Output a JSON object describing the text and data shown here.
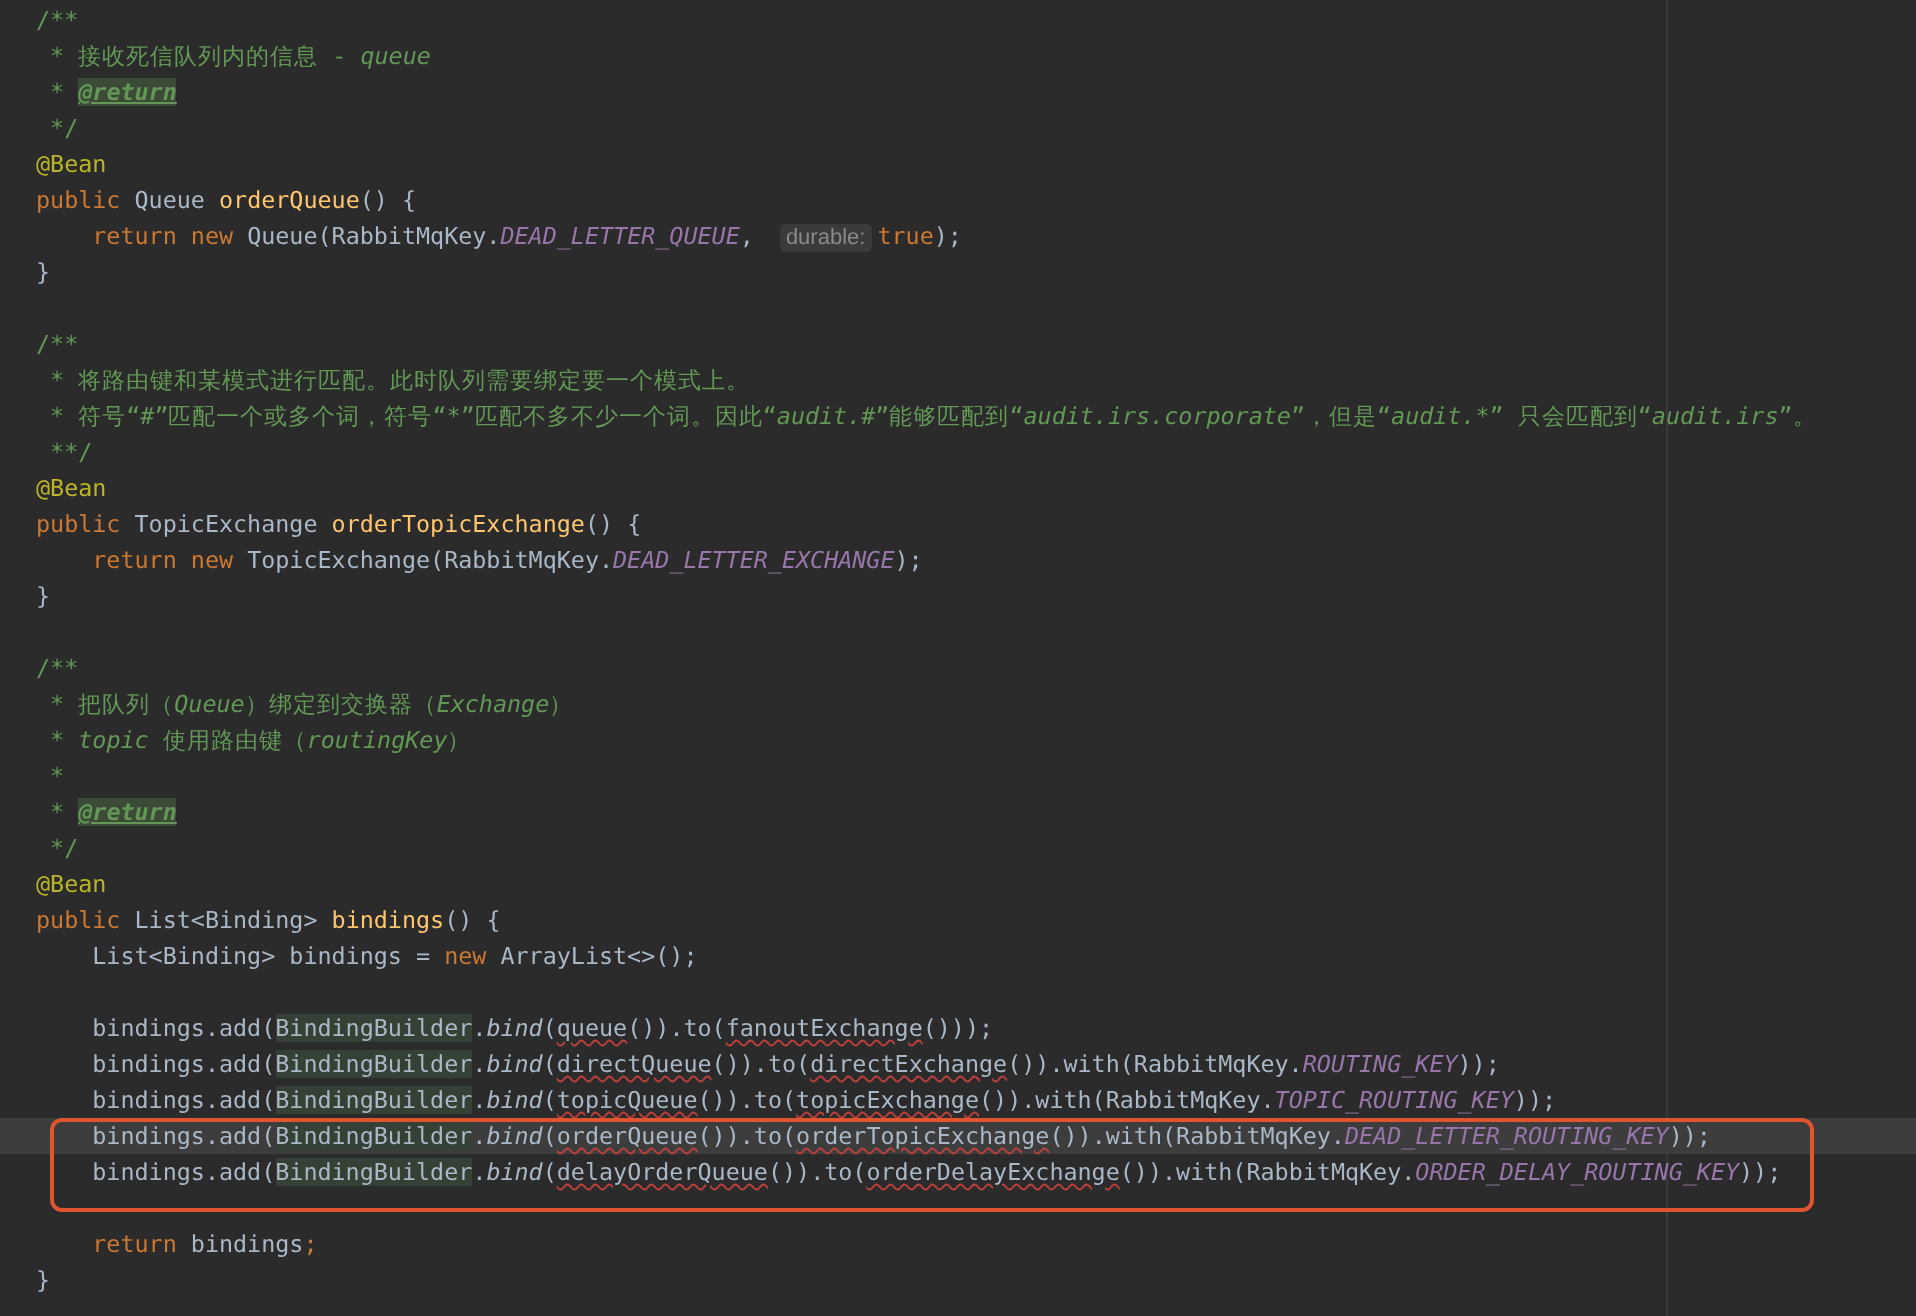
{
  "lines": [
    {
      "kind": "code",
      "current": false,
      "boxed": false,
      "tokens": [
        {
          "kind": "doc",
          "text": "/**"
        }
      ]
    },
    {
      "kind": "code",
      "current": false,
      "boxed": false,
      "tokens": [
        {
          "kind": "doc",
          "text": " * 接收死信队列内的信息 - "
        },
        {
          "kind": "doci",
          "text": "queue"
        }
      ]
    },
    {
      "kind": "code",
      "current": false,
      "boxed": false,
      "tokens": [
        {
          "kind": "doc",
          "text": " * "
        },
        {
          "kind": "tag",
          "text": "@return"
        }
      ]
    },
    {
      "kind": "code",
      "current": false,
      "boxed": false,
      "tokens": [
        {
          "kind": "doc",
          "text": " */"
        }
      ]
    },
    {
      "kind": "code",
      "current": false,
      "boxed": false,
      "tokens": [
        {
          "kind": "ann",
          "text": "@Bean"
        }
      ]
    },
    {
      "kind": "code",
      "current": false,
      "boxed": false,
      "tokens": [
        {
          "kind": "kw",
          "text": "public "
        },
        {
          "kind": "plain",
          "text": "Queue "
        },
        {
          "kind": "fn",
          "text": "orderQueue"
        },
        {
          "kind": "plain",
          "text": "() {"
        }
      ]
    },
    {
      "kind": "code",
      "current": false,
      "boxed": false,
      "tokens": [
        {
          "kind": "kw",
          "text": "    return new "
        },
        {
          "kind": "plain",
          "text": "Queue(RabbitMqKey."
        },
        {
          "kind": "const",
          "text": "DEAD_LETTER_QUEUE"
        },
        {
          "kind": "plain",
          "text": ", "
        },
        {
          "kind": "hint",
          "text": "durable:"
        },
        {
          "kind": "kw",
          "text": "true"
        },
        {
          "kind": "plain",
          "text": ");"
        }
      ]
    },
    {
      "kind": "code",
      "current": false,
      "boxed": false,
      "tokens": [
        {
          "kind": "plain",
          "text": "}"
        }
      ]
    },
    {
      "kind": "blank",
      "current": false,
      "boxed": false
    },
    {
      "kind": "code",
      "current": false,
      "boxed": false,
      "tokens": [
        {
          "kind": "doc",
          "text": "/**"
        }
      ]
    },
    {
      "kind": "code",
      "current": false,
      "boxed": false,
      "tokens": [
        {
          "kind": "doc",
          "text": " * 将路由键和某模式进行匹配。此时队列需要绑定要一个模式上。"
        }
      ]
    },
    {
      "kind": "code",
      "current": false,
      "boxed": false,
      "tokens": [
        {
          "kind": "doc",
          "text": " * 符号“"
        },
        {
          "kind": "doci",
          "text": "#"
        },
        {
          "kind": "doc",
          "text": "”匹配一个或多个词，符号“"
        },
        {
          "kind": "doci",
          "text": "*"
        },
        {
          "kind": "doc",
          "text": "”匹配不多不少一个词。因此“"
        },
        {
          "kind": "doci",
          "text": "audit.#"
        },
        {
          "kind": "doc",
          "text": "”能够匹配到“"
        },
        {
          "kind": "doci",
          "text": "audit.irs.corporate"
        },
        {
          "kind": "doc",
          "text": "”，但是“"
        },
        {
          "kind": "doci",
          "text": "audit.*"
        },
        {
          "kind": "doc",
          "text": "” 只会匹配到“"
        },
        {
          "kind": "doci",
          "text": "audit.irs"
        },
        {
          "kind": "doc",
          "text": "”。"
        }
      ]
    },
    {
      "kind": "code",
      "current": false,
      "boxed": false,
      "tokens": [
        {
          "kind": "doc",
          "text": " **/"
        }
      ]
    },
    {
      "kind": "code",
      "current": false,
      "boxed": false,
      "tokens": [
        {
          "kind": "ann",
          "text": "@Bean"
        }
      ]
    },
    {
      "kind": "code",
      "current": false,
      "boxed": false,
      "tokens": [
        {
          "kind": "kw",
          "text": "public "
        },
        {
          "kind": "plain",
          "text": "TopicExchange "
        },
        {
          "kind": "fn",
          "text": "orderTopicExchange"
        },
        {
          "kind": "plain",
          "text": "() {"
        }
      ]
    },
    {
      "kind": "code",
      "current": false,
      "boxed": false,
      "tokens": [
        {
          "kind": "kw",
          "text": "    return new "
        },
        {
          "kind": "plain",
          "text": "TopicExchange(RabbitMqKey."
        },
        {
          "kind": "const",
          "text": "DEAD_LETTER_EXCHANGE"
        },
        {
          "kind": "plain",
          "text": ");"
        }
      ]
    },
    {
      "kind": "code",
      "current": false,
      "boxed": false,
      "tokens": [
        {
          "kind": "plain",
          "text": "}"
        }
      ]
    },
    {
      "kind": "blank",
      "current": false,
      "boxed": false
    },
    {
      "kind": "code",
      "current": false,
      "boxed": false,
      "tokens": [
        {
          "kind": "doc",
          "text": "/**"
        }
      ]
    },
    {
      "kind": "code",
      "current": false,
      "boxed": false,
      "tokens": [
        {
          "kind": "doc",
          "text": " * 把队列（"
        },
        {
          "kind": "doci",
          "text": "Queue"
        },
        {
          "kind": "doc",
          "text": "）绑定到交换器（"
        },
        {
          "kind": "doci",
          "text": "Exchange"
        },
        {
          "kind": "doc",
          "text": "）"
        }
      ]
    },
    {
      "kind": "code",
      "current": false,
      "boxed": false,
      "tokens": [
        {
          "kind": "doc",
          "text": " * "
        },
        {
          "kind": "doci",
          "text": "topic"
        },
        {
          "kind": "doc",
          "text": " 使用路由键（"
        },
        {
          "kind": "doci",
          "text": "routingKey"
        },
        {
          "kind": "doc",
          "text": "）"
        }
      ]
    },
    {
      "kind": "code",
      "current": false,
      "boxed": false,
      "tokens": [
        {
          "kind": "doc",
          "text": " *"
        }
      ]
    },
    {
      "kind": "code",
      "current": false,
      "boxed": false,
      "tokens": [
        {
          "kind": "doc",
          "text": " * "
        },
        {
          "kind": "tag",
          "text": "@return"
        }
      ]
    },
    {
      "kind": "code",
      "current": false,
      "boxed": false,
      "tokens": [
        {
          "kind": "doc",
          "text": " */"
        }
      ]
    },
    {
      "kind": "code",
      "current": false,
      "boxed": false,
      "tokens": [
        {
          "kind": "ann",
          "text": "@Bean"
        }
      ]
    },
    {
      "kind": "code",
      "current": false,
      "boxed": false,
      "tokens": [
        {
          "kind": "kw",
          "text": "public "
        },
        {
          "kind": "plain",
          "text": "List<Binding> "
        },
        {
          "kind": "fn",
          "text": "bindings"
        },
        {
          "kind": "plain",
          "text": "() {"
        }
      ]
    },
    {
      "kind": "code",
      "current": false,
      "boxed": false,
      "tokens": [
        {
          "kind": "plain",
          "text": "    List<Binding> bindings = "
        },
        {
          "kind": "kw",
          "text": "new "
        },
        {
          "kind": "plain",
          "text": "ArrayList<>();"
        }
      ]
    },
    {
      "kind": "blank",
      "current": false,
      "boxed": false
    },
    {
      "kind": "code",
      "current": false,
      "boxed": false,
      "tokens": [
        {
          "kind": "plain",
          "text": "    bindings.add("
        },
        {
          "kind": "cls",
          "text": "BindingBuilder"
        },
        {
          "kind": "plain",
          "text": "."
        },
        {
          "kind": "static",
          "text": "bind"
        },
        {
          "kind": "plain",
          "text": "("
        },
        {
          "kind": "warn",
          "text": "queue"
        },
        {
          "kind": "plain",
          "text": "()).to("
        },
        {
          "kind": "warn",
          "text": "fanoutExchange"
        },
        {
          "kind": "plain",
          "text": "()));"
        }
      ]
    },
    {
      "kind": "code",
      "current": false,
      "boxed": false,
      "tokens": [
        {
          "kind": "plain",
          "text": "    bindings.add("
        },
        {
          "kind": "cls",
          "text": "BindingBuilder"
        },
        {
          "kind": "plain",
          "text": "."
        },
        {
          "kind": "static",
          "text": "bind"
        },
        {
          "kind": "plain",
          "text": "("
        },
        {
          "kind": "warn",
          "text": "directQueue"
        },
        {
          "kind": "plain",
          "text": "()).to("
        },
        {
          "kind": "warn",
          "text": "directExchange"
        },
        {
          "kind": "plain",
          "text": "()).with(RabbitMqKey."
        },
        {
          "kind": "const",
          "text": "ROUTING_KEY"
        },
        {
          "kind": "plain",
          "text": "));"
        }
      ]
    },
    {
      "kind": "code",
      "current": false,
      "boxed": false,
      "tokens": [
        {
          "kind": "plain",
          "text": "    bindings.add("
        },
        {
          "kind": "cls",
          "text": "BindingBuilder"
        },
        {
          "kind": "plain",
          "text": "."
        },
        {
          "kind": "static",
          "text": "bind"
        },
        {
          "kind": "plain",
          "text": "("
        },
        {
          "kind": "warn",
          "text": "topicQueue"
        },
        {
          "kind": "plain",
          "text": "()).to("
        },
        {
          "kind": "warn",
          "text": "topicExchange"
        },
        {
          "kind": "plain",
          "text": "()).with(RabbitMqKey."
        },
        {
          "kind": "const",
          "text": "TOPIC_ROUTING_KEY"
        },
        {
          "kind": "plain",
          "text": "));"
        }
      ]
    },
    {
      "kind": "code",
      "current": true,
      "boxed": true,
      "tokens": [
        {
          "kind": "plain",
          "text": "    bindings.add("
        },
        {
          "kind": "cls",
          "text": "BindingBuilder"
        },
        {
          "kind": "plain",
          "text": "."
        },
        {
          "kind": "static",
          "text": "bind"
        },
        {
          "kind": "plain",
          "text": "("
        },
        {
          "kind": "warn",
          "text": "orderQueue"
        },
        {
          "kind": "plain",
          "text": "()).to("
        },
        {
          "kind": "warn",
          "text": "orderTopicExchange"
        },
        {
          "kind": "plain",
          "text": "()).with(RabbitMqKey."
        },
        {
          "kind": "const",
          "text": "DEAD_LETTER_ROUTING_KEY"
        },
        {
          "kind": "plain",
          "text": "));"
        }
      ]
    },
    {
      "kind": "code",
      "current": false,
      "boxed": true,
      "tokens": [
        {
          "kind": "plain",
          "text": "    bindings.add("
        },
        {
          "kind": "cls",
          "text": "BindingBuilder"
        },
        {
          "kind": "plain",
          "text": "."
        },
        {
          "kind": "static",
          "text": "bind"
        },
        {
          "kind": "plain",
          "text": "("
        },
        {
          "kind": "warn",
          "text": "delayOrderQueue"
        },
        {
          "kind": "plain",
          "text": "()).to("
        },
        {
          "kind": "warn",
          "text": "orderDelayExchange"
        },
        {
          "kind": "plain",
          "text": "()).with(RabbitMqKey."
        },
        {
          "kind": "const",
          "text": "ORDER_DELAY_ROUTING_KEY"
        },
        {
          "kind": "plain",
          "text": "));"
        }
      ]
    },
    {
      "kind": "blank",
      "current": false,
      "boxed": false
    },
    {
      "kind": "code",
      "current": false,
      "boxed": false,
      "tokens": [
        {
          "kind": "kw",
          "text": "    return "
        },
        {
          "kind": "plain",
          "text": "bindings"
        },
        {
          "kind": "kw",
          "text": ";"
        }
      ]
    },
    {
      "kind": "code",
      "current": false,
      "boxed": false,
      "tokens": [
        {
          "kind": "plain",
          "text": "}"
        }
      ]
    }
  ]
}
